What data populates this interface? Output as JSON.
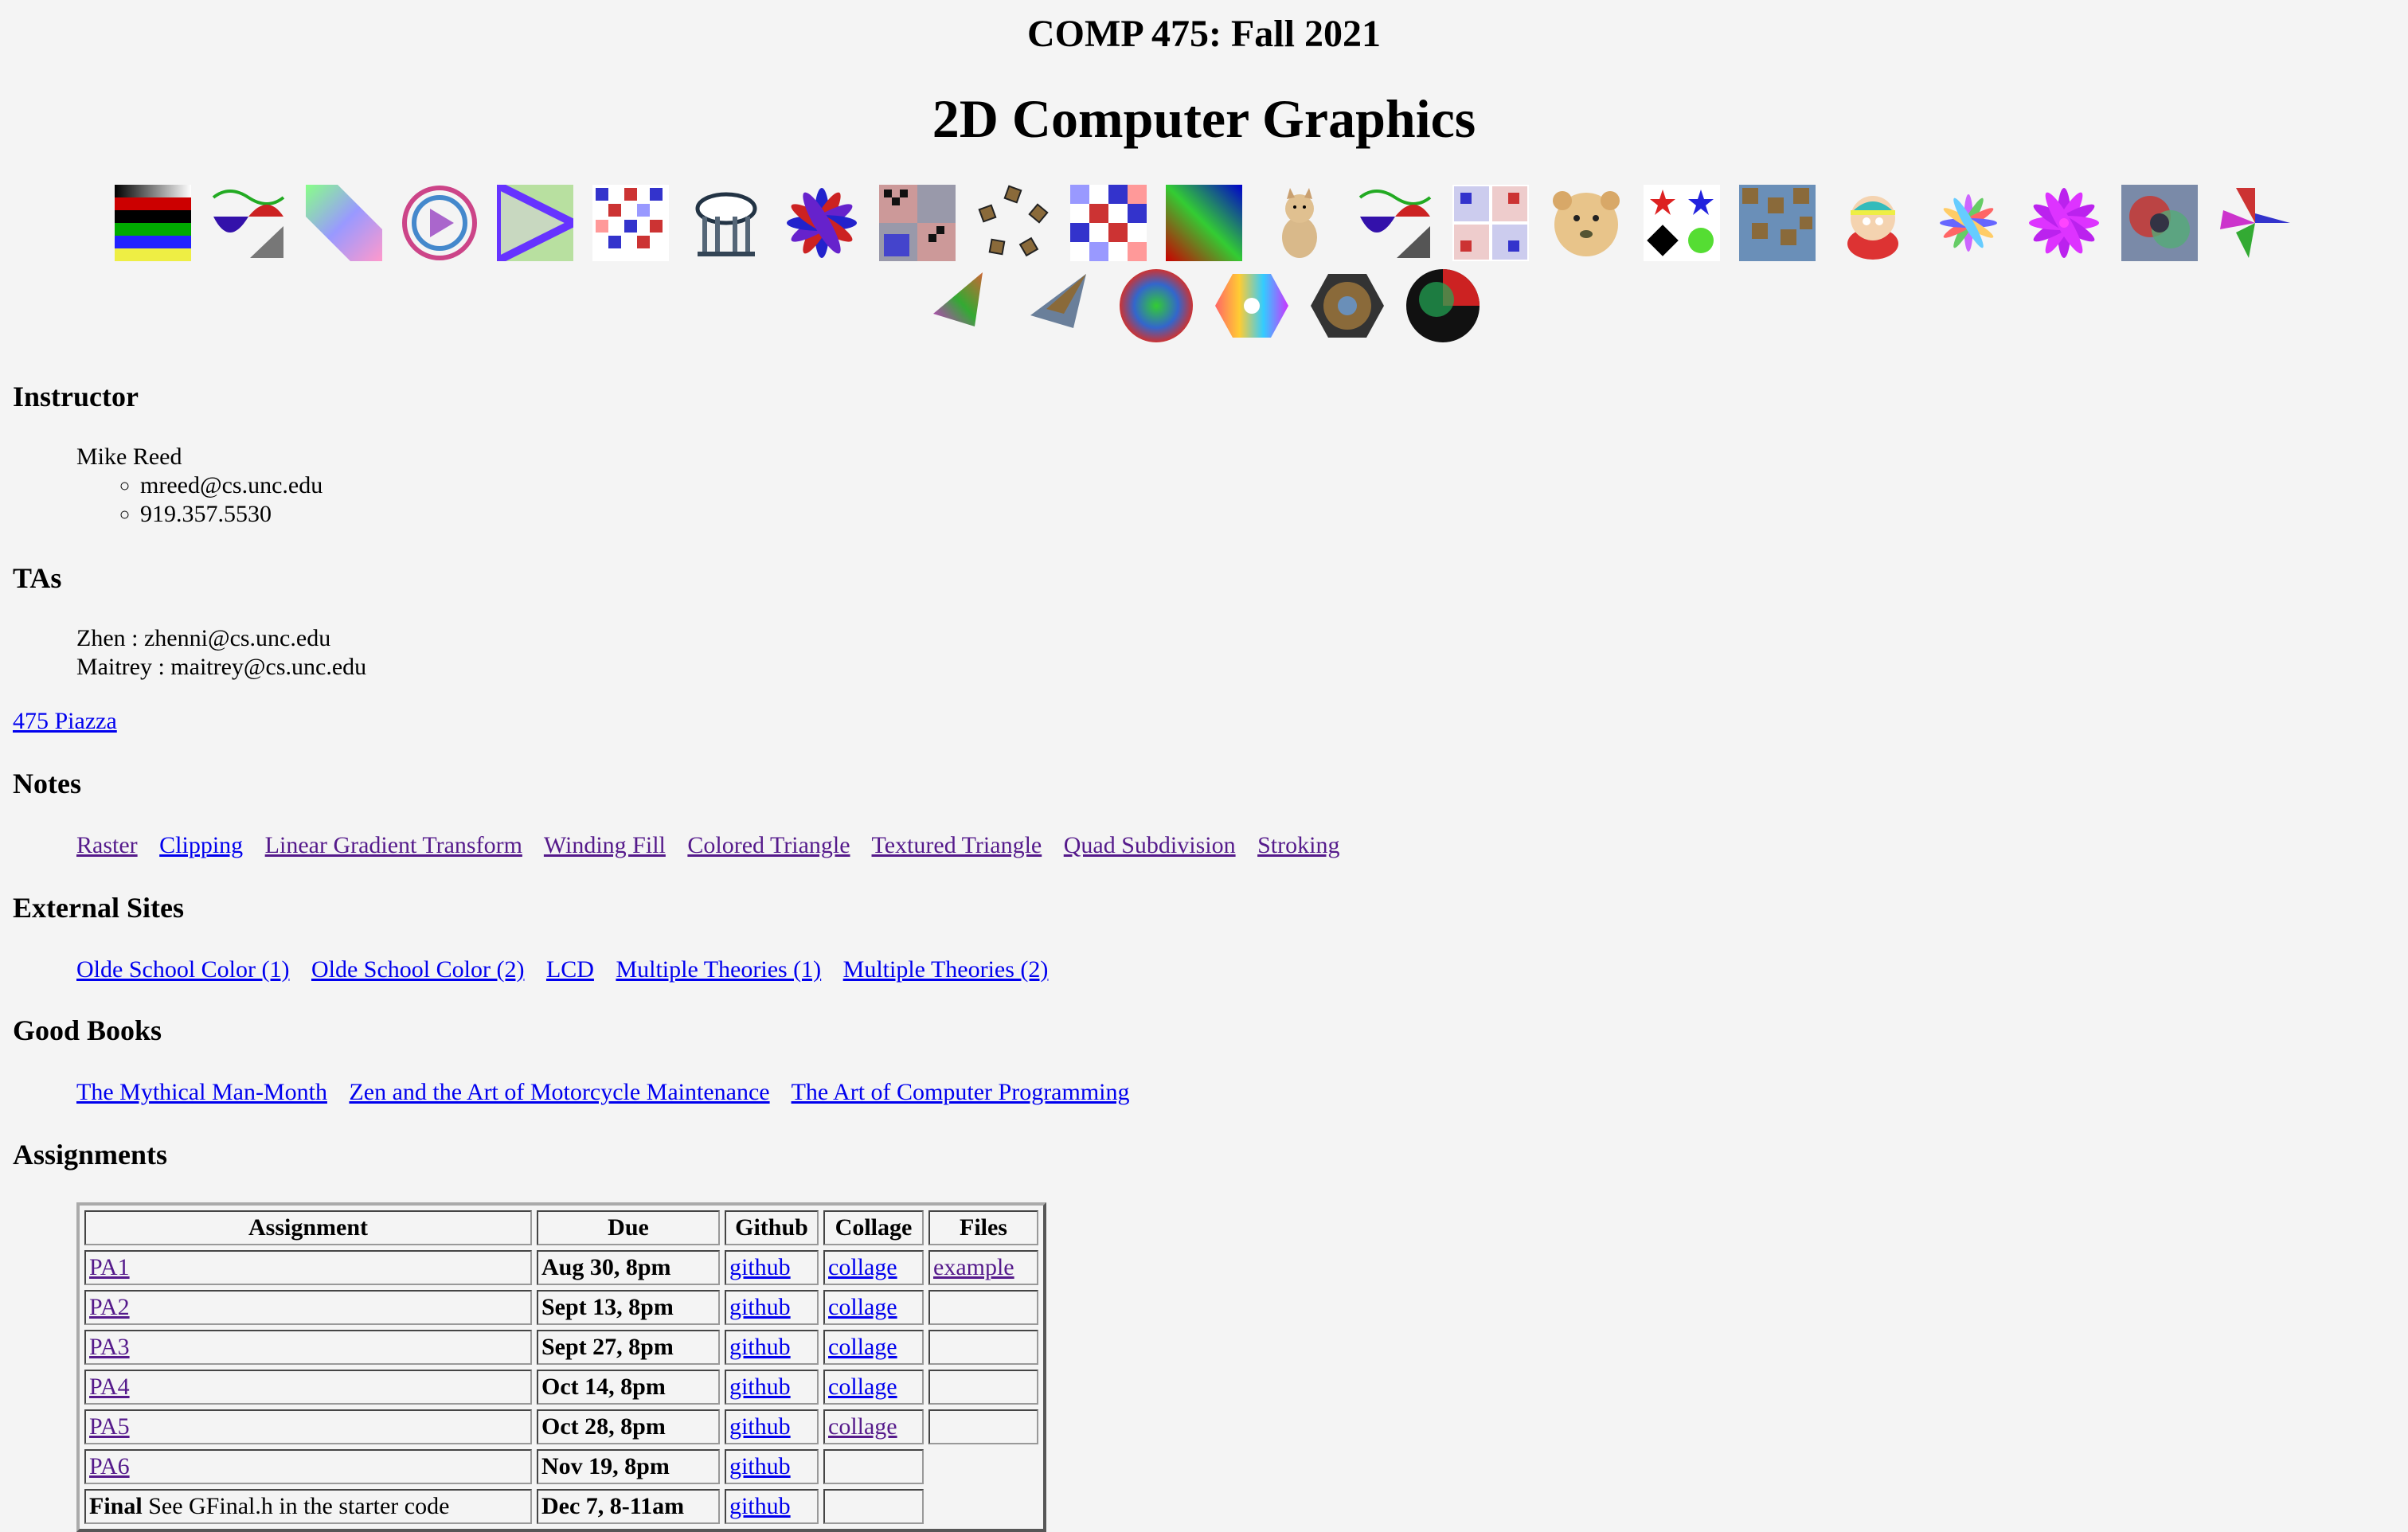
{
  "header": {
    "course": "COMP 475: Fall 2021",
    "subtitle": "2D Computer Graphics"
  },
  "gallery": {
    "row1": [
      "stripes-thumb",
      "wave-triangle-thumb",
      "gradient-diagonal-thumb",
      "polygon-rings-thumb",
      "triangle-square-thumb",
      "checker-grid-thumb",
      "old-well-thumb",
      "flower-blue-red-thumb",
      "checker-quad-thumb",
      "pentagon-photo-thumb",
      "checker-grid-2-thumb",
      "green-gradient-square-thumb",
      "cat-thumb",
      "wave-triangle-2-thumb",
      "quad-grid-thumb",
      "lion-cub-thumb",
      "star-shapes-thumb",
      "tiled-photo-thumb",
      "cartman-thumb",
      "spiral-flower-thumb",
      "purple-flower-thumb",
      "abstract-photo-thumb",
      "pinwheel-thumb"
    ],
    "row2": [
      "color-triangle-thumb",
      "textured-triangle-thumb",
      "radial-circle-thumb",
      "hexagon-gradient-thumb",
      "hexagon-photo-thumb",
      "dark-sweep-circle-thumb"
    ]
  },
  "instructor": {
    "heading": "Instructor",
    "name": "Mike Reed",
    "email": "mreed@cs.unc.edu",
    "phone": "919.357.5530"
  },
  "tas": {
    "heading": "TAs",
    "list": [
      "Zhen : zhenni@cs.unc.edu",
      "Maitrey : maitrey@cs.unc.edu"
    ]
  },
  "piazza": "475 Piazza",
  "notes": {
    "heading": "Notes",
    "links": [
      "Raster",
      "Clipping",
      "Linear Gradient Transform",
      "Winding Fill",
      "Colored Triangle",
      "Textured Triangle",
      "Quad Subdivision",
      "Stroking"
    ]
  },
  "external": {
    "heading": "External Sites",
    "links": [
      "Olde School Color (1)",
      "Olde School Color (2)",
      "LCD",
      "Multiple Theories (1)",
      "Multiple Theories (2)"
    ]
  },
  "books": {
    "heading": "Good Books",
    "links": [
      "The Mythical Man-Month",
      "Zen and the Art of Motorcycle Maintenance",
      "The Art of Computer Programming"
    ]
  },
  "assignments": {
    "heading": "Assignments",
    "columns": [
      "Assignment",
      "Due",
      "Github",
      "Collage",
      "Files"
    ],
    "rows": [
      {
        "name": "PA1",
        "due": "Aug 30, 8pm",
        "github": "github",
        "collage": "collage",
        "files": "example"
      },
      {
        "name": "PA2",
        "due": "Sept 13, 8pm",
        "github": "github",
        "collage": "collage",
        "files": ""
      },
      {
        "name": "PA3",
        "due": "Sept 27, 8pm",
        "github": "github",
        "collage": "collage",
        "files": ""
      },
      {
        "name": "PA4",
        "due": "Oct 14, 8pm",
        "github": "github",
        "collage": "collage",
        "files": ""
      },
      {
        "name": "PA5",
        "due": "Oct 28, 8pm",
        "github": "github",
        "collage": "collage",
        "files": ""
      },
      {
        "name": "PA6",
        "due": "Nov 19, 8pm",
        "github": "github",
        "collage": "",
        "files": ""
      },
      {
        "name": "Final",
        "name_note": "See GFinal.h in the starter code",
        "due": "Dec 7, 8-11am",
        "github": "github",
        "collage": "",
        "files": ""
      }
    ]
  }
}
